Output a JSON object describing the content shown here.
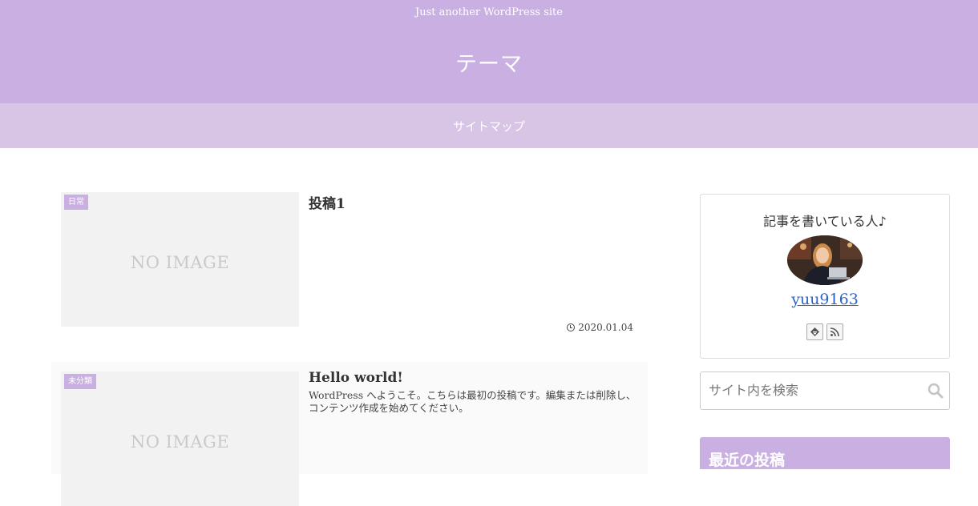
{
  "header": {
    "tagline": "Just another WordPress site",
    "site_title": "テーマ"
  },
  "nav": {
    "items": [
      {
        "label": "サイトマップ"
      }
    ]
  },
  "posts": [
    {
      "category": "日常",
      "thumbnail_text": "NO IMAGE",
      "title": "投稿1",
      "excerpt": "",
      "date": "2020.01.04"
    },
    {
      "category": "未分類",
      "thumbnail_text": "NO IMAGE",
      "title": "Hello world!",
      "excerpt": "WordPress へようこそ。こちらは最初の投稿です。編集または削除し、コンテンツ作成を始めてください。",
      "date": ""
    }
  ],
  "sidebar": {
    "author": {
      "heading": "記事を書いている人♪",
      "name": "yuu9163",
      "social_icons": [
        "feedly-icon",
        "rss-icon"
      ]
    },
    "search": {
      "placeholder": "サイト内を検索",
      "icon": "search-icon"
    },
    "recent_posts": {
      "title": "最近の投稿"
    }
  },
  "colors": {
    "accent": "#cab0e2",
    "nav_bg": "#d8c5e5",
    "link": "#2a62c8"
  }
}
